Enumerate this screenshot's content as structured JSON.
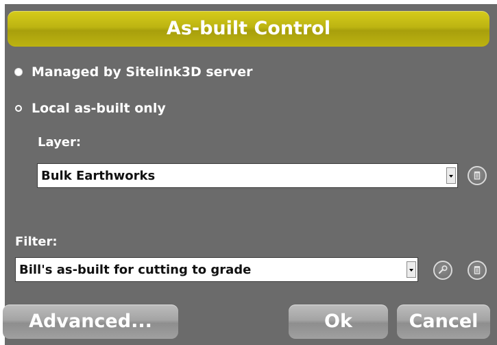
{
  "dialog": {
    "title": "As-built Control",
    "options": [
      {
        "label": "Managed by Sitelink3D server",
        "selected": true
      },
      {
        "label": "Local as-built only",
        "selected": false
      }
    ],
    "layer": {
      "label": "Layer:",
      "value": "Bulk Earthworks"
    },
    "filter": {
      "label": "Filter:",
      "value": "Bill's as-built for cutting to grade"
    }
  },
  "buttons": {
    "advanced": "Advanced...",
    "ok": "Ok",
    "cancel": "Cancel"
  },
  "colors": {
    "panel": "#6b6b6b",
    "title_bar": "#bdb412",
    "button": "#a4a4a4"
  },
  "icons": {
    "layer_delete": "trash-icon",
    "filter_edit": "wrench-icon",
    "filter_delete": "trash-icon"
  }
}
